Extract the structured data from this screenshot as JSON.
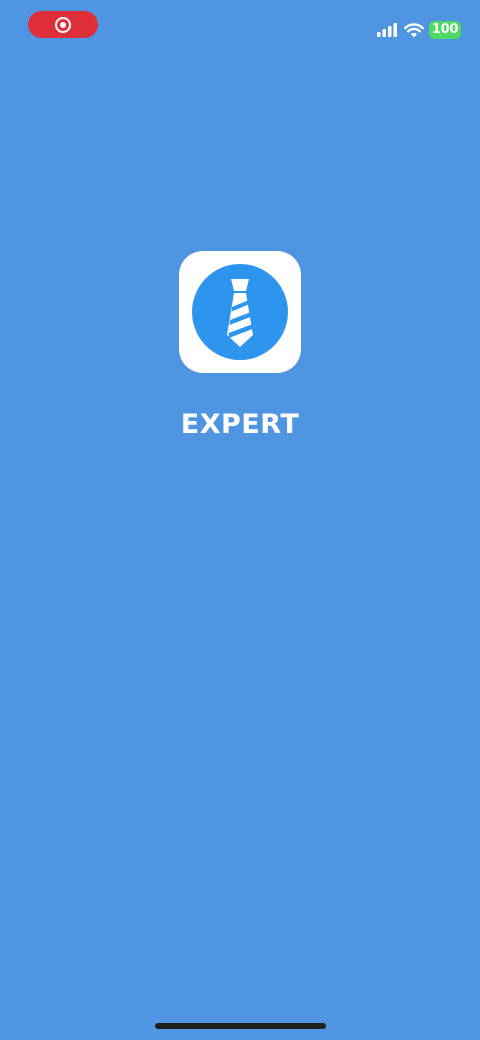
{
  "status_bar": {
    "battery_level": "100",
    "recording_indicator_color": "#df2f3a",
    "battery_color": "#4cd964",
    "icons": [
      "record-icon",
      "cellular-signal-icon",
      "wifi-icon",
      "battery-icon"
    ]
  },
  "splash": {
    "app_name": "EXPERT",
    "background_color": "#4f95e2",
    "logo_icon": "necktie-icon",
    "logo_circle_color": "#2e95ef"
  }
}
